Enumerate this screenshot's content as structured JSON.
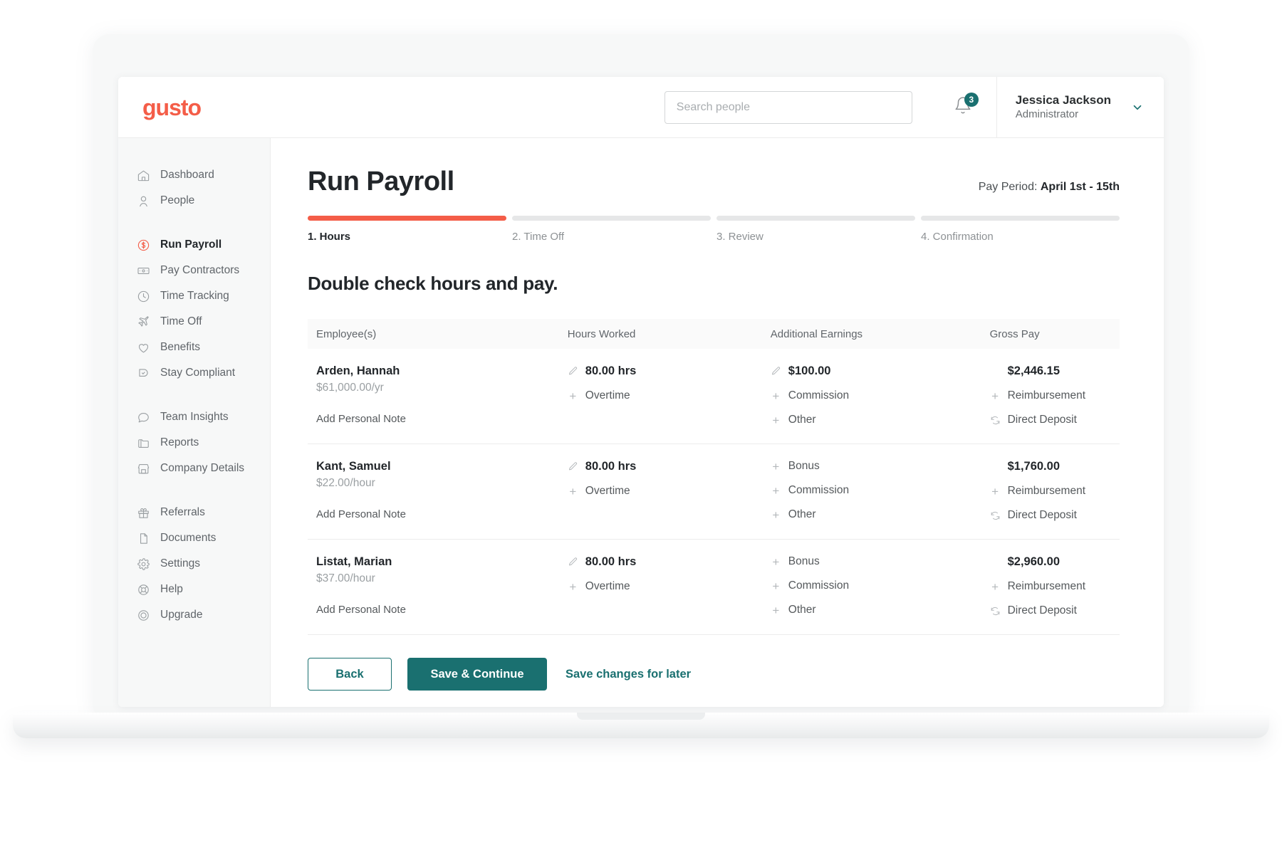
{
  "brand": {
    "logo_text": "gusto",
    "coral": "#f45d48",
    "teal": "#1a7070"
  },
  "topbar": {
    "search_placeholder": "Search people",
    "notification_count": "3",
    "user_name": "Jessica Jackson",
    "user_role": "Administrator"
  },
  "sidebar": {
    "groups": [
      {
        "items": [
          {
            "label": "Dashboard",
            "icon": "home-icon",
            "active": false
          },
          {
            "label": "People",
            "icon": "person-icon",
            "active": false
          }
        ]
      },
      {
        "items": [
          {
            "label": "Run Payroll",
            "icon": "dollar-circle-icon",
            "active": true
          },
          {
            "label": "Pay Contractors",
            "icon": "money-bill-icon",
            "active": false
          },
          {
            "label": "Time Tracking",
            "icon": "clock-icon",
            "active": false
          },
          {
            "label": "Time Off",
            "icon": "airplane-icon",
            "active": false
          },
          {
            "label": "Benefits",
            "icon": "heart-icon",
            "active": false
          },
          {
            "label": "Stay Compliant",
            "icon": "shield-check-icon",
            "active": false
          }
        ]
      },
      {
        "items": [
          {
            "label": "Team Insights",
            "icon": "chat-bubble-icon",
            "active": false
          },
          {
            "label": "Reports",
            "icon": "folder-icon",
            "active": false
          },
          {
            "label": "Company Details",
            "icon": "storefront-icon",
            "active": false
          }
        ]
      },
      {
        "items": [
          {
            "label": "Referrals",
            "icon": "gift-icon",
            "active": false
          },
          {
            "label": "Documents",
            "icon": "document-icon",
            "active": false
          },
          {
            "label": "Settings",
            "icon": "gear-icon",
            "active": false
          },
          {
            "label": "Help",
            "icon": "lifebuoy-icon",
            "active": false
          },
          {
            "label": "Upgrade",
            "icon": "circle-arrow-icon",
            "active": false
          }
        ]
      }
    ]
  },
  "page": {
    "title": "Run Payroll",
    "pay_period_label": "Pay Period: ",
    "pay_period_value": "April 1st - 15th",
    "section_title": "Double check hours and pay."
  },
  "steps": [
    {
      "label": "1. Hours",
      "done": true
    },
    {
      "label": "2. Time Off",
      "done": false
    },
    {
      "label": "3. Review",
      "done": false
    },
    {
      "label": "4. Confirmation",
      "done": false
    }
  ],
  "table": {
    "headers": {
      "employees": "Employee(s)",
      "hours_worked": "Hours Worked",
      "additional_earnings": "Additional Earnings",
      "gross_pay": "Gross Pay"
    },
    "rows": [
      {
        "name": "Arden, Hannah",
        "rate": "$61,000.00/yr",
        "note_label": "Add Personal Note",
        "hours": "80.00 hrs",
        "overtime_label": "Overtime",
        "earnings_value": "$100.00",
        "earnings_value_is_amount": true,
        "earnings_links": [
          "Commission",
          "Other"
        ],
        "gross_pay": "$2,446.15",
        "reimbursement_label": "Reimbursement",
        "direct_deposit_label": "Direct Deposit"
      },
      {
        "name": "Kant, Samuel",
        "rate": "$22.00/hour",
        "note_label": "Add Personal Note",
        "hours": "80.00 hrs",
        "overtime_label": "Overtime",
        "earnings_value": "Bonus",
        "earnings_value_is_amount": false,
        "earnings_links": [
          "Commission",
          "Other"
        ],
        "gross_pay": "$1,760.00",
        "reimbursement_label": "Reimbursement",
        "direct_deposit_label": "Direct Deposit"
      },
      {
        "name": "Listat, Marian",
        "rate": "$37.00/hour",
        "note_label": "Add Personal Note",
        "hours": "80.00 hrs",
        "overtime_label": "Overtime",
        "earnings_value": "Bonus",
        "earnings_value_is_amount": false,
        "earnings_links": [
          "Commission",
          "Other"
        ],
        "gross_pay": "$2,960.00",
        "reimbursement_label": "Reimbursement",
        "direct_deposit_label": "Direct Deposit"
      }
    ]
  },
  "footer": {
    "back_label": "Back",
    "save_continue_label": "Save & Continue",
    "save_later_label": "Save changes for later"
  }
}
